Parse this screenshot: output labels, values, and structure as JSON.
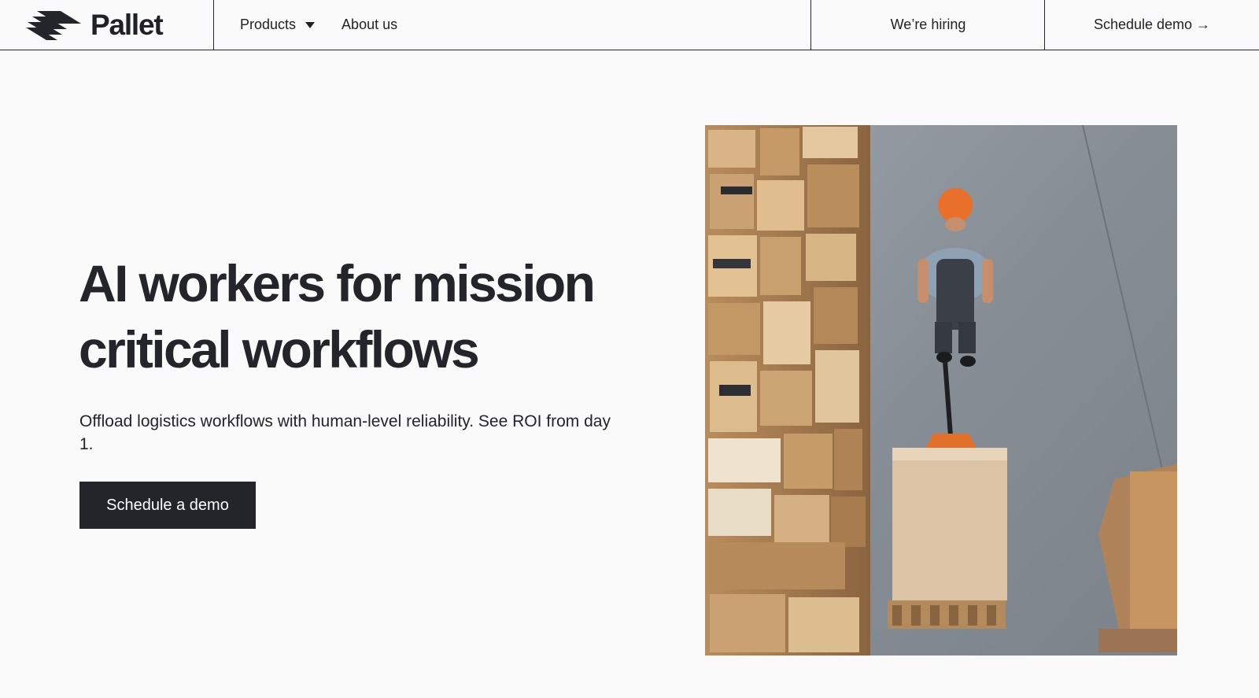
{
  "brand": {
    "name": "Pallet",
    "logo_icon": "stacked-stripes-logo"
  },
  "nav": {
    "products_label": "Products",
    "products_icon": "caret-down-icon",
    "about_label": "About us",
    "hiring_label": "We’re hiring",
    "demo_label": "Schedule demo",
    "demo_arrow": "→"
  },
  "hero": {
    "title_line1": "AI workers for mission",
    "title_line2": "critical workflows",
    "subtitle": "Offload logistics workflows with human-level reliability. See ROI from day 1.",
    "cta_label": "Schedule a demo",
    "image": "warehouse-worker-with-pallet-jack-photo"
  },
  "colors": {
    "background": "#fafafa",
    "ink": "#23252b",
    "button_text": "#ffffff"
  }
}
